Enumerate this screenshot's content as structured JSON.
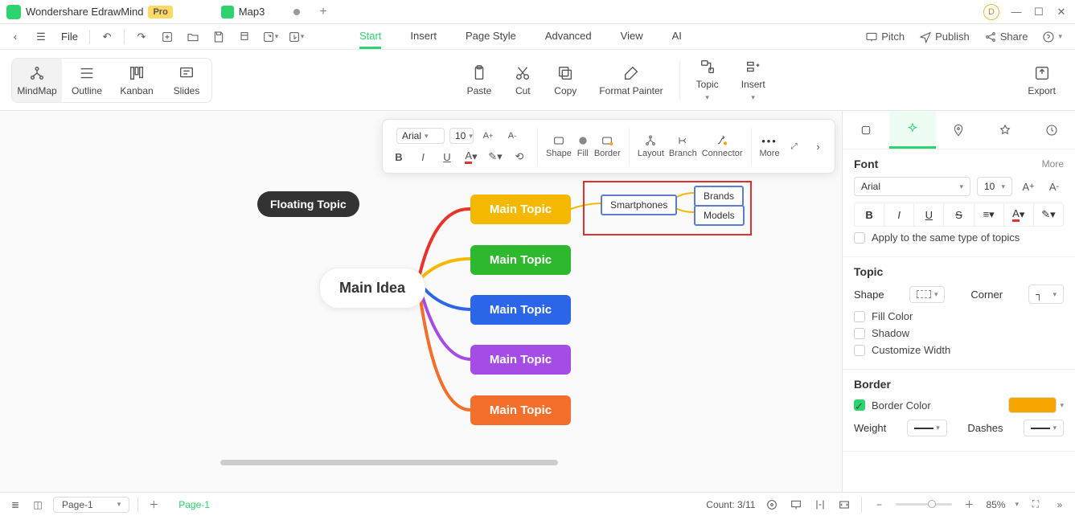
{
  "titlebar": {
    "app_name": "Wondershare EdrawMind",
    "pro_badge": "Pro",
    "doc_tab": "Map3",
    "avatar_letter": "D"
  },
  "toolbar": {
    "file_label": "File",
    "right": {
      "pitch": "Pitch",
      "publish": "Publish",
      "share": "Share"
    }
  },
  "menu": {
    "tabs": [
      "Start",
      "Insert",
      "Page Style",
      "Advanced",
      "View",
      "AI"
    ],
    "active": "Start"
  },
  "ribbon": {
    "views": [
      "MindMap",
      "Outline",
      "Kanban",
      "Slides"
    ],
    "active_view": "MindMap",
    "actions": {
      "paste": "Paste",
      "cut": "Cut",
      "copy": "Copy",
      "format_painter": "Format Painter",
      "topic": "Topic",
      "insert": "Insert",
      "export": "Export"
    }
  },
  "minibar": {
    "font": "Arial",
    "size": "10",
    "shape": "Shape",
    "fill": "Fill",
    "border": "Border",
    "layout": "Layout",
    "branch": "Branch",
    "connector": "Connector",
    "more": "More"
  },
  "canvas": {
    "floating": "Floating Topic",
    "main_idea": "Main Idea",
    "topics": [
      "Main Topic",
      "Main Topic",
      "Main Topic",
      "Main Topic",
      "Main Topic"
    ],
    "sub_smartphones": "Smartphones",
    "sub_brands": "Brands",
    "sub_models": "Models"
  },
  "panel": {
    "font_title": "Font",
    "more": "More",
    "font_family": "Arial",
    "font_size": "10",
    "apply_same": "Apply to the same type of topics",
    "topic_title": "Topic",
    "shape_label": "Shape",
    "corner_label": "Corner",
    "fill_color": "Fill Color",
    "shadow": "Shadow",
    "custom_width": "Customize Width",
    "border_title": "Border",
    "border_color": "Border Color",
    "weight": "Weight",
    "dashes": "Dashes",
    "border_color_value": "#f5a400"
  },
  "statusbar": {
    "page_selector": "Page-1",
    "page_label": "Page-1",
    "count": "Count: 3/11",
    "zoom": "85%"
  }
}
